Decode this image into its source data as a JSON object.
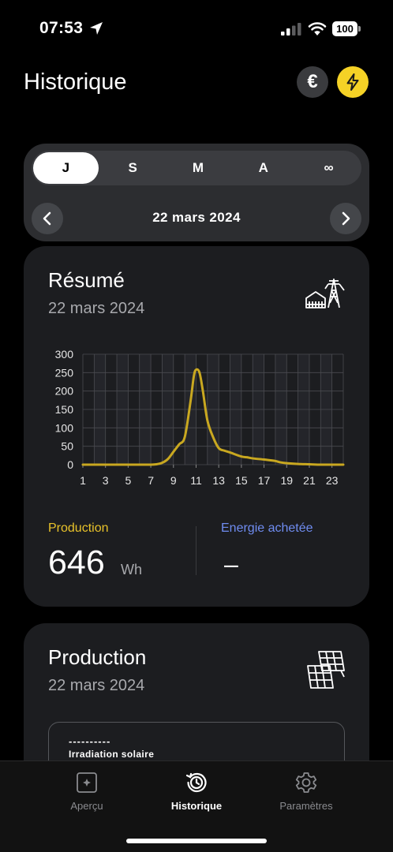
{
  "status_bar": {
    "time": "07:53",
    "battery": "100",
    "icons": [
      "location-arrow-icon",
      "signal-icon",
      "wifi-icon",
      "battery-icon"
    ]
  },
  "header": {
    "title": "Historique",
    "icons": [
      "euro-icon",
      "lightning-icon"
    ],
    "accent_color": "#f5d226"
  },
  "period_selector": {
    "tabs": [
      {
        "label": "J",
        "active": true
      },
      {
        "label": "S",
        "active": false
      },
      {
        "label": "M",
        "active": false
      },
      {
        "label": "A",
        "active": false
      },
      {
        "label": "∞",
        "active": false
      }
    ],
    "date": "22 mars 2024",
    "prev_icon": "chevron-left-icon",
    "next_icon": "chevron-right-icon"
  },
  "summary": {
    "title": "Résumé",
    "date": "22 mars 2024",
    "icon": "house-pylon-icon",
    "production_label": "Production",
    "production_value": "646",
    "production_unit": "Wh",
    "purchased_label": "Energie achetée",
    "purchased_value": "–",
    "production_color": "#e8c22a",
    "purchased_color": "#6f8cf0"
  },
  "production": {
    "title": "Production",
    "date": "22 mars 2024",
    "icon": "solar-panel-icon",
    "irradiation_dashes": "----------",
    "irradiation_title": "Irradiation solaire"
  },
  "tab_bar": {
    "tabs": [
      {
        "label": "Aperçu",
        "icon": "overview-icon",
        "active": false
      },
      {
        "label": "Historique",
        "icon": "history-icon",
        "active": true
      },
      {
        "label": "Paramètres",
        "icon": "settings-gear-icon",
        "active": false
      }
    ]
  },
  "chart_data": {
    "type": "line",
    "title": "",
    "xlabel": "",
    "ylabel": "",
    "x_ticks": [
      "1",
      "3",
      "5",
      "7",
      "9",
      "11",
      "13",
      "15",
      "17",
      "19",
      "21",
      "23"
    ],
    "y_ticks": [
      "0",
      "50",
      "100",
      "150",
      "200",
      "250",
      "300"
    ],
    "xlim": [
      1,
      24
    ],
    "ylim": [
      0,
      300
    ],
    "grid": true,
    "series": [
      {
        "color": "#c9a820",
        "x": [
          1,
          2,
          3,
          4,
          5,
          6,
          7,
          7.5,
          8,
          8.5,
          9,
          9.5,
          10,
          10.5,
          10.8,
          11,
          11.3,
          11.6,
          12,
          12.5,
          13,
          13.5,
          14,
          15,
          15.5,
          16,
          17,
          17.5,
          18,
          18.5,
          19,
          20,
          21,
          22,
          23,
          24
        ],
        "y": [
          0,
          0,
          0,
          0,
          0,
          0,
          0,
          1,
          5,
          15,
          35,
          55,
          75,
          170,
          240,
          258,
          250,
          200,
          120,
          75,
          45,
          38,
          33,
          22,
          20,
          17,
          14,
          12,
          10,
          6,
          4,
          2,
          1,
          0,
          0,
          0
        ]
      }
    ]
  }
}
